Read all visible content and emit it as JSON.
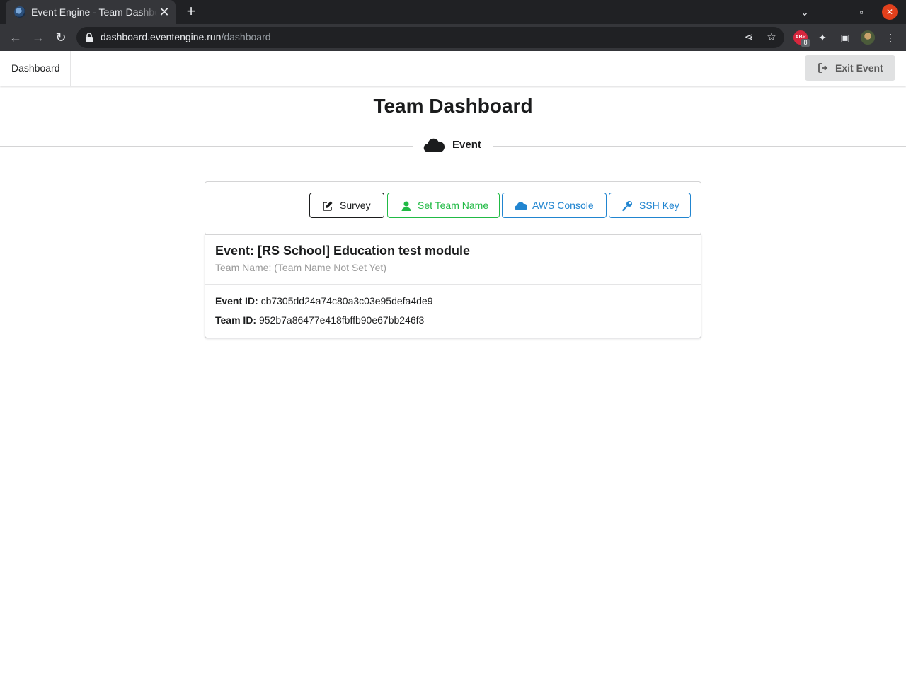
{
  "browser": {
    "tab_title": "Event Engine - Team Dashboard",
    "url_host": "dashboard.eventengine.run",
    "url_path": "/dashboard",
    "extension_badge": "8"
  },
  "header": {
    "nav_dashboard": "Dashboard",
    "exit_label": "Exit Event"
  },
  "page": {
    "title": "Team Dashboard",
    "section_label": "Event"
  },
  "actions": {
    "survey": "Survey",
    "set_team_name": "Set Team Name",
    "aws_console": "AWS Console",
    "ssh_key": "SSH Key"
  },
  "event": {
    "title": "Event: [RS School] Education test module",
    "team_name_line": "Team Name: (Team Name Not Set Yet)",
    "event_id_label": "Event ID:",
    "event_id": "cb7305dd24a74c80a3c03e95defa4de9",
    "team_id_label": "Team ID:",
    "team_id": "952b7a86477e418fbffb90e67bb246f3"
  },
  "colors": {
    "green": "#21ba45",
    "blue": "#2185d0",
    "dark": "#1b1c1d"
  }
}
